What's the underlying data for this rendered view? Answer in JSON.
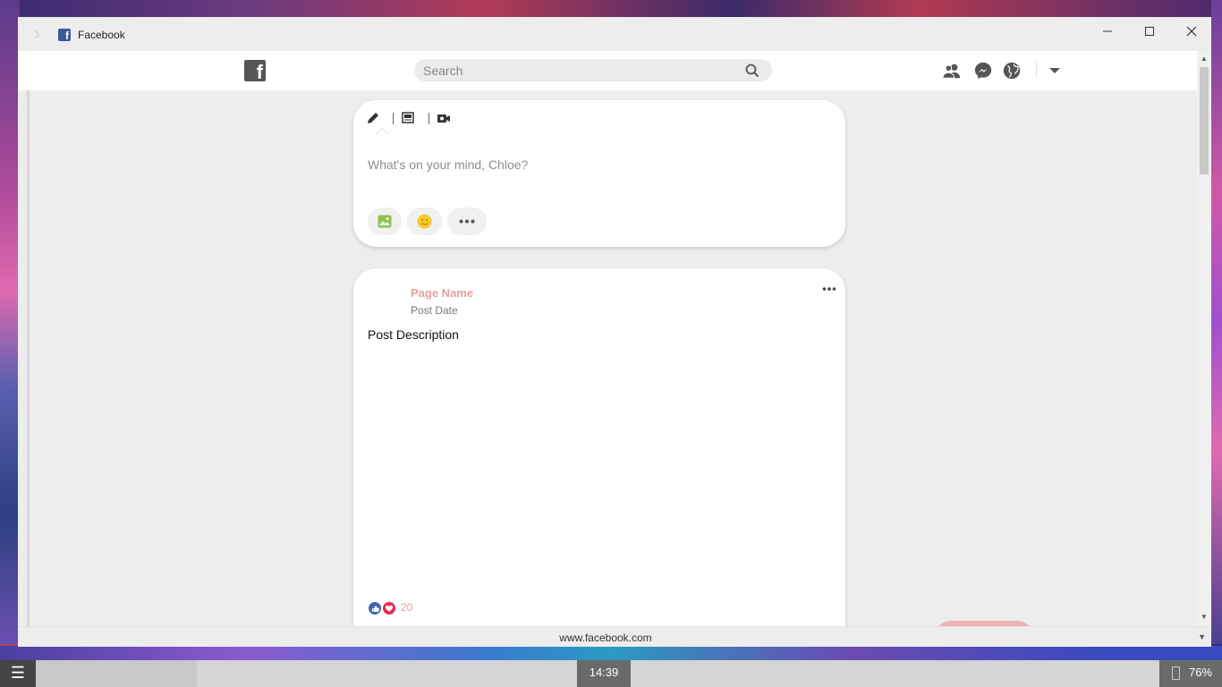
{
  "window": {
    "title": "Facebook",
    "controls": {
      "minimize": "—",
      "maximize": "☐",
      "close": "✕"
    }
  },
  "navbar": {
    "logo_letter": "f",
    "search_placeholder": "Search",
    "icons": [
      "friends-icon",
      "messenger-icon",
      "globe-icon",
      "dropdown-caret-icon"
    ]
  },
  "composer": {
    "tabs": [
      "status-pencil-icon",
      "photo-album-icon",
      "video-camera-icon"
    ],
    "placeholder": "What's on your mind, Chloe?",
    "actions": [
      "photo-icon",
      "feeling-emoji-icon",
      "more-options-icon"
    ]
  },
  "post": {
    "page_name": "Page Name",
    "post_date": "Post Date",
    "description": "Post Description",
    "reaction_count": "20",
    "reactions": [
      "like-icon",
      "love-icon"
    ]
  },
  "chat": {
    "status": "online",
    "icons": [
      "gear-icon",
      "compose-icon",
      "contacts-icon"
    ]
  },
  "status_bar": {
    "url": "www.facebook.com"
  },
  "taskbar": {
    "menu_glyph": "☰",
    "clock": "14:39",
    "battery": "76%"
  },
  "colors": {
    "accent_pink": "#e8a0a0",
    "chat_pill": "#efb1b1",
    "online_green": "#1a9a2a",
    "like_blue": "#4267b2",
    "love_red": "#f0284a"
  }
}
